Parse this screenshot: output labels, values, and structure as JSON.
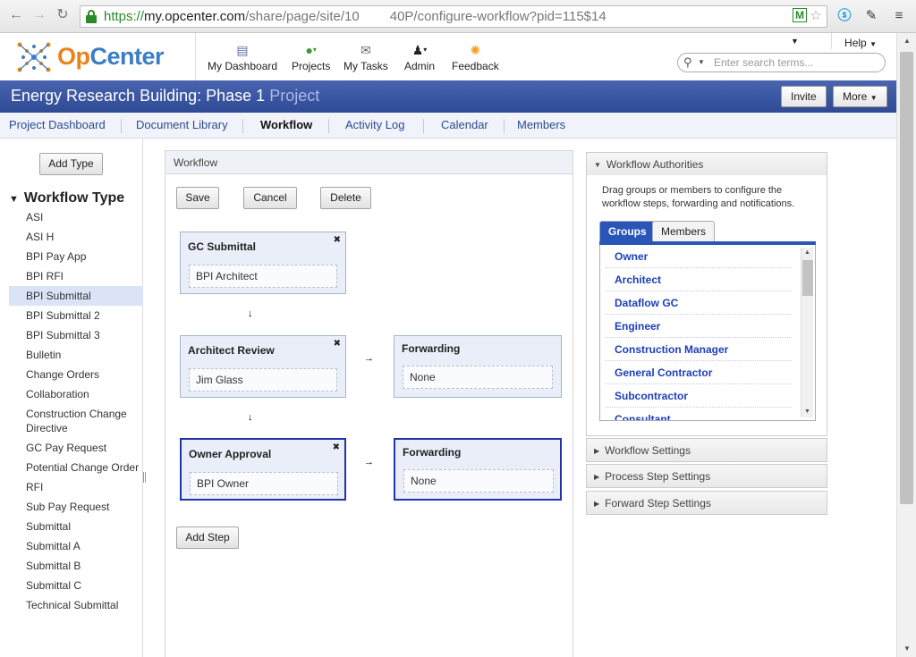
{
  "browser": {
    "url_proto": "https://",
    "url_host": "my.opcenter.com",
    "url_path": "/share/page/site/10",
    "url_path2": "40P/configure-workflow?pid=115$14"
  },
  "header": {
    "logo_op": "Op",
    "logo_center": "Center",
    "nav": [
      "My Dashboard",
      "Projects",
      "My Tasks",
      "Admin",
      "Feedback"
    ],
    "help": "Help",
    "search_placeholder": "Enter search terms..."
  },
  "project": {
    "title": "Energy Research Building: Phase 1",
    "subtitle": "Project",
    "invite": "Invite",
    "more": "More"
  },
  "tabs": [
    "Project Dashboard",
    "Document Library",
    "Workflow",
    "Activity Log",
    "Calendar",
    "Members"
  ],
  "sidebar": {
    "add_type": "Add Type",
    "title": "Workflow Type",
    "items": [
      "ASI",
      "ASI H",
      "BPI Pay App",
      "BPI RFI",
      "BPI Submittal",
      "BPI Submittal 2",
      "BPI Submittal 3",
      "Bulletin",
      "Change Orders",
      "Collaboration",
      "Construction Change Directive",
      "GC Pay Request",
      "Potential Change Order",
      "RFI",
      "Sub Pay Request",
      "Submittal",
      "Submittal A",
      "Submittal B",
      "Submittal C",
      "Technical Submittal"
    ],
    "selected": "BPI Submittal"
  },
  "workflow": {
    "panel_title": "Workflow",
    "save": "Save",
    "cancel": "Cancel",
    "delete": "Delete",
    "add_step": "Add Step",
    "steps": [
      {
        "title": "GC Submittal",
        "assignee": "BPI Architect"
      },
      {
        "title": "Architect Review",
        "assignee": "Jim Glass",
        "forward_title": "Forwarding",
        "forward_value": "None"
      },
      {
        "title": "Owner Approval",
        "assignee": "BPI Owner",
        "forward_title": "Forwarding",
        "forward_value": "None"
      }
    ]
  },
  "authorities": {
    "title": "Workflow Authorities",
    "description": "Drag groups or members to configure the workflow steps, forwarding and notifications.",
    "tab_groups": "Groups",
    "tab_members": "Members",
    "groups": [
      "Owner",
      "Architect",
      "Dataflow GC",
      "Engineer",
      "Construction Manager",
      "General Contractor",
      "Subcontractor",
      "Consultant"
    ],
    "sections": [
      "Workflow Settings",
      "Process Step Settings",
      "Forward Step Settings"
    ]
  },
  "colors": {
    "accent": "#2a55b8",
    "projbar": "#3a56a2",
    "logo_orange": "#e8841c",
    "logo_blue": "#3b7dc8"
  }
}
